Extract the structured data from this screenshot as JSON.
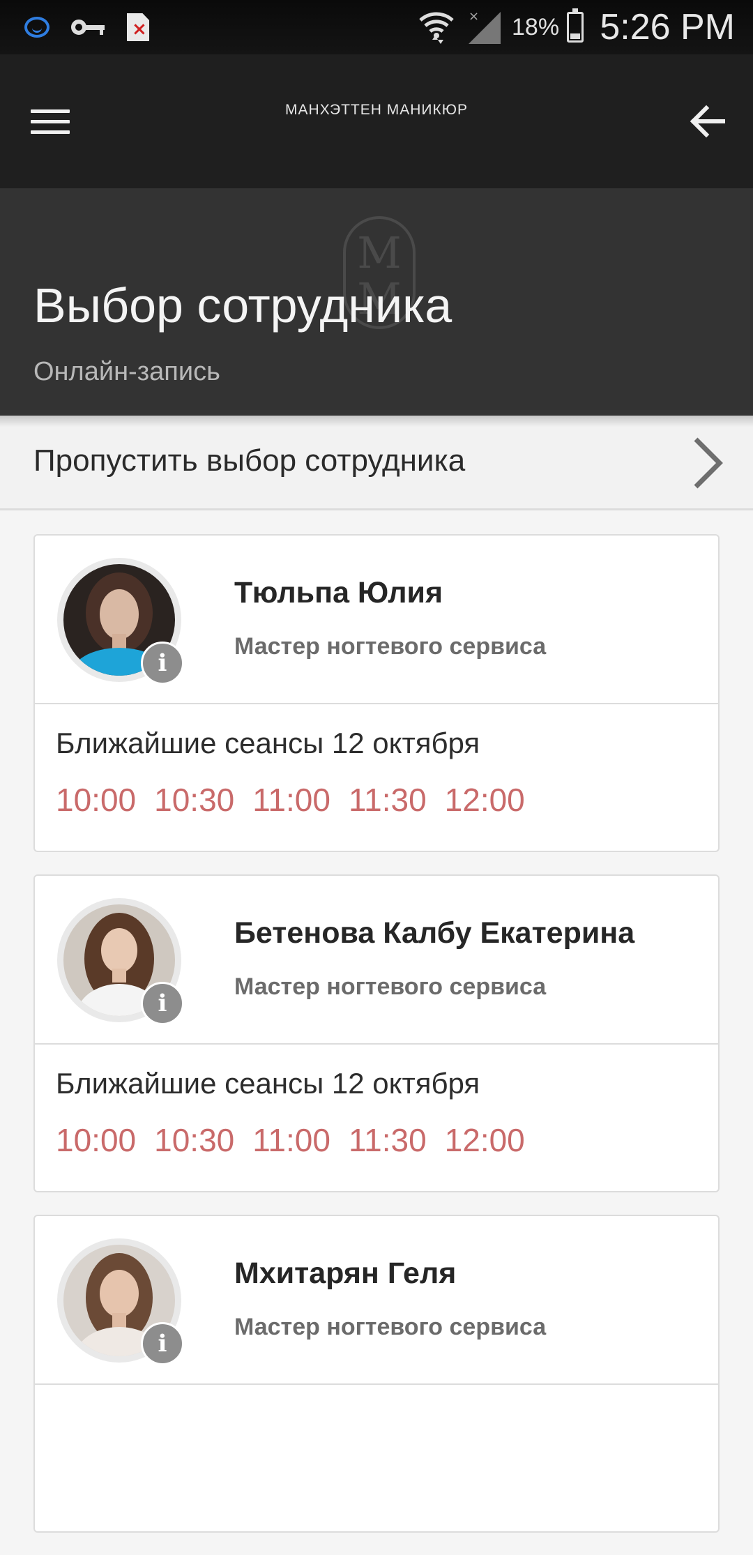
{
  "status_bar": {
    "icons": [
      "assistant-icon",
      "key-icon",
      "file-error-icon",
      "wifi-icon",
      "signal-icon",
      "battery-icon"
    ],
    "battery_percent": "18%",
    "time": "5:26 PM"
  },
  "app_bar": {
    "title": "МАНХЭТТЕН МАНИКЮР",
    "menu_icon": "hamburger-menu-icon",
    "back_icon": "arrow-back-icon"
  },
  "hero": {
    "title": "Выбор сотрудника",
    "subtitle": "Онлайн-запись",
    "logo_letters": "MM"
  },
  "skip": {
    "label": "Пропустить выбор сотрудника",
    "icon": "chevron-right-icon"
  },
  "staff": [
    {
      "name": "Тюльпа Юлия",
      "role": "Мастер ногтевого сервиса",
      "sessions_label": "Ближайшие сеансы 12 октября",
      "slots": [
        "10:00",
        "10:30",
        "11:00",
        "11:30",
        "12:00"
      ]
    },
    {
      "name": "Бетенова Калбу Екатерина",
      "role": "Мастер ногтевого сервиса",
      "sessions_label": "Ближайшие сеансы 12 октября",
      "slots": [
        "10:00",
        "10:30",
        "11:00",
        "11:30",
        "12:00"
      ]
    },
    {
      "name": "Мхитарян Геля",
      "role": "Мастер ногтевого сервиса",
      "sessions_label": "",
      "slots": []
    }
  ],
  "info_badge_glyph": "i",
  "colors": {
    "app_bar": "#1f1f1f",
    "hero": "#333333",
    "slot_text": "#c96a6a",
    "background": "#f5f5f5"
  }
}
